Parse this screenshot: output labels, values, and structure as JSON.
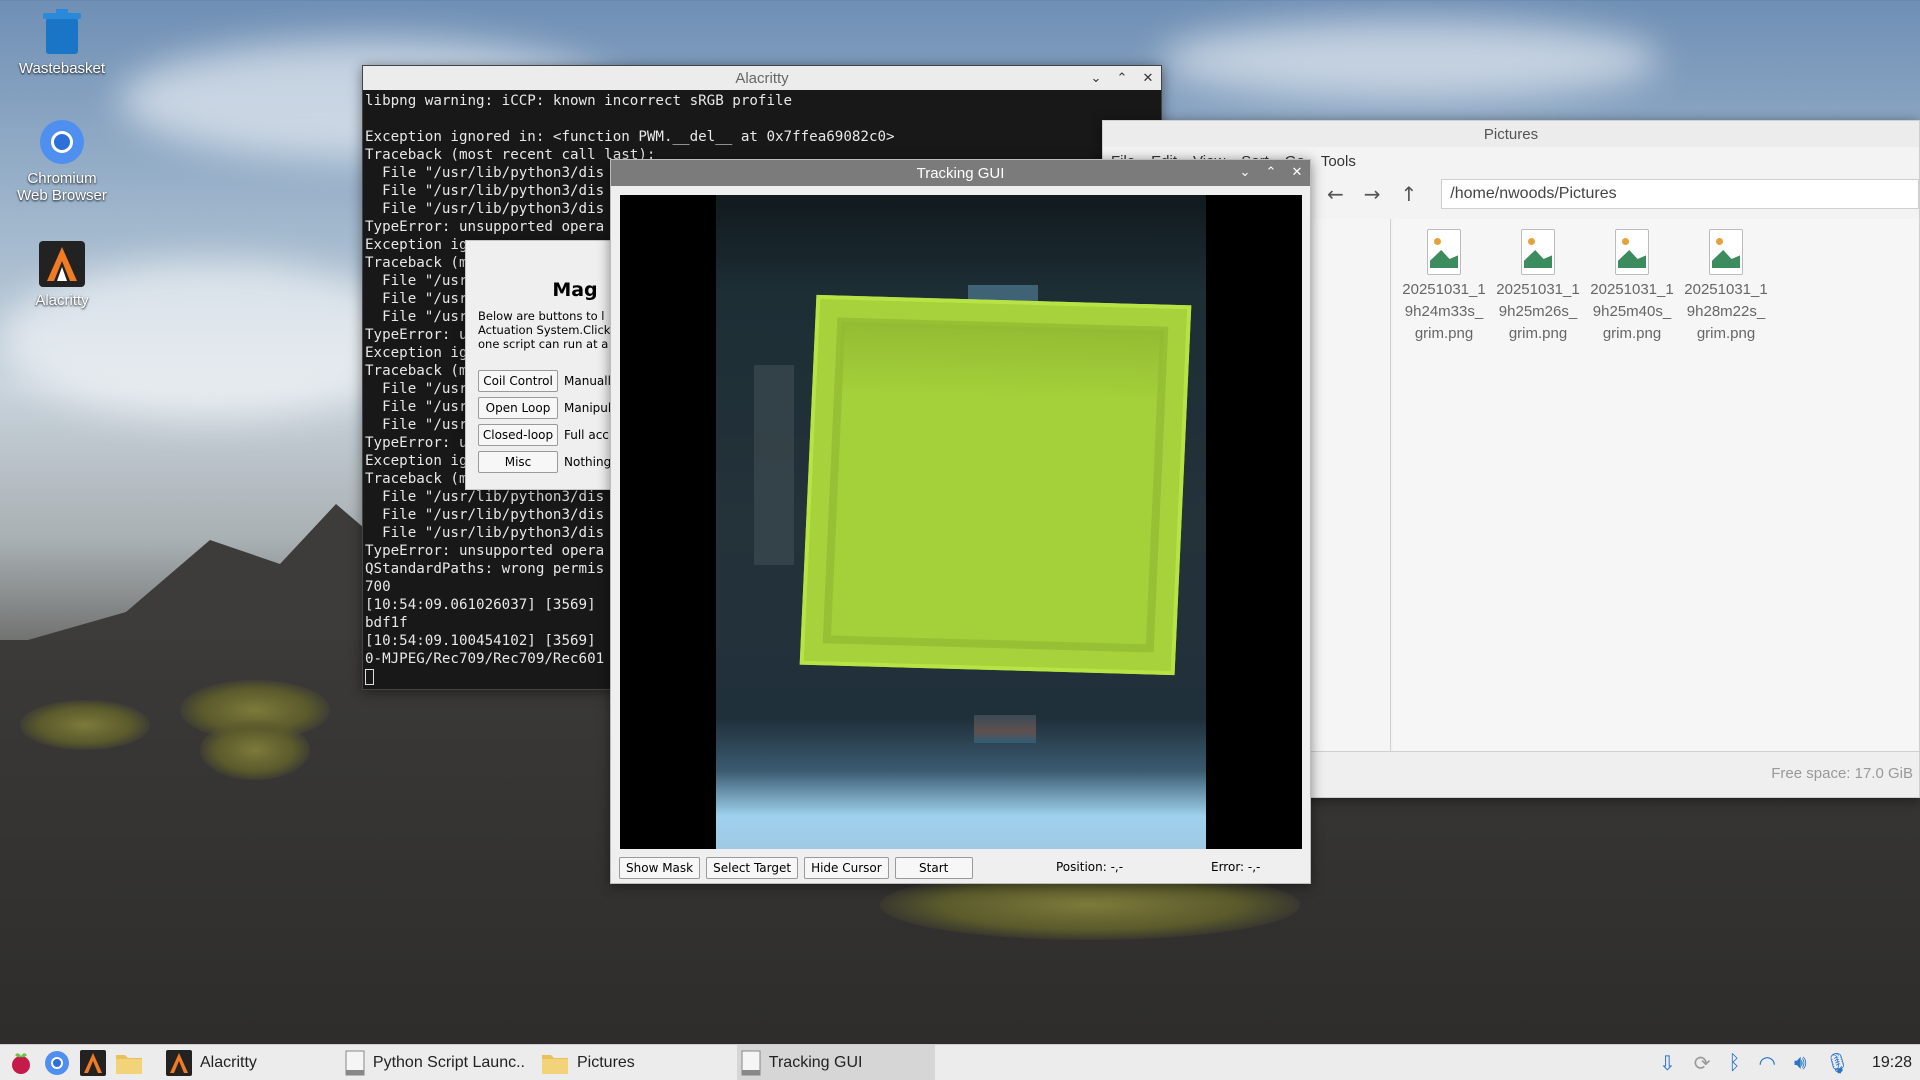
{
  "desktop": {
    "icons": [
      {
        "label": "Wastebasket",
        "icon": "trash-icon"
      },
      {
        "label": "Chromium\nWeb Browser",
        "icon": "chromium-icon"
      },
      {
        "label": "Alacritty",
        "icon": "alacritty-icon"
      }
    ]
  },
  "alacritty": {
    "title": "Alacritty",
    "lines": [
      "libpng warning: iCCP: known incorrect sRGB profile",
      "",
      "Exception ignored in: <function PWM.__del__ at 0x7ffea69082c0>",
      "Traceback (most recent call last):",
      "  File \"/usr/lib/python3/dis",
      "  File \"/usr/lib/python3/dis",
      "  File \"/usr/lib/python3/dis",
      "TypeError: unsupported opera",
      "Exception ig",
      "Traceback (m",
      "  File \"/usr",
      "  File \"/usr",
      "  File \"/usr",
      "TypeError: u",
      "Exception ig",
      "Traceback (m",
      "  File \"/usr",
      "  File \"/usr",
      "  File \"/usr",
      "TypeError: u",
      "Exception ig",
      "Traceback (m",
      "  File \"/usr/lib/python3/dis",
      "  File \"/usr/lib/python3/dis",
      "  File \"/usr/lib/python3/dis",
      "TypeError: unsupported opera",
      "QStandardPaths: wrong permis",
      "700",
      "[10:54:09.061026037] [3569]",
      "bdf1f",
      "[10:54:09.100454102] [3569]",
      "0-MJPEG/Rec709/Rec709/Rec601"
    ]
  },
  "launcher": {
    "heading": "Mag",
    "description": [
      "Below are buttons to l",
      "Actuation System.Click",
      "one script can run at a"
    ],
    "rows": [
      {
        "button": "Coil Control",
        "text": "Manuall"
      },
      {
        "button": "Open Loop",
        "text": "Manipul"
      },
      {
        "button": "Closed-loop",
        "text": "Full acc"
      },
      {
        "button": "Misc",
        "text": "Nothing"
      }
    ]
  },
  "files": {
    "title": "Pictures",
    "menu": [
      "File",
      "Edit",
      "View",
      "Sort",
      "Go",
      "Tools"
    ],
    "path": "/home/nwoods/Pictures",
    "items": [
      {
        "name": "20251031_1\n9h24m33s_\ngrim.png"
      },
      {
        "name": "20251031_1\n9h25m26s_\ngrim.png"
      },
      {
        "name": "20251031_1\n9h25m40s_\ngrim.png"
      },
      {
        "name": "20251031_1\n9h28m22s_\ngrim.png"
      }
    ],
    "status": "Free space: 17.0 GiB"
  },
  "tracking": {
    "title": "Tracking GUI",
    "buttons": [
      "Show Mask",
      "Select Target",
      "Hide Cursor",
      "Start"
    ],
    "position": "Position: -,-",
    "error": "Error: -,-"
  },
  "taskbar": {
    "tasks": [
      {
        "label": "Alacritty",
        "icon": "alacritty-icon"
      },
      {
        "label": "Python Script Launc..",
        "icon": "window-icon"
      },
      {
        "label": "Pictures",
        "icon": "folder-icon"
      },
      {
        "label": "Tracking GUI",
        "icon": "window-icon",
        "active": true
      }
    ],
    "clock": "19:28"
  }
}
